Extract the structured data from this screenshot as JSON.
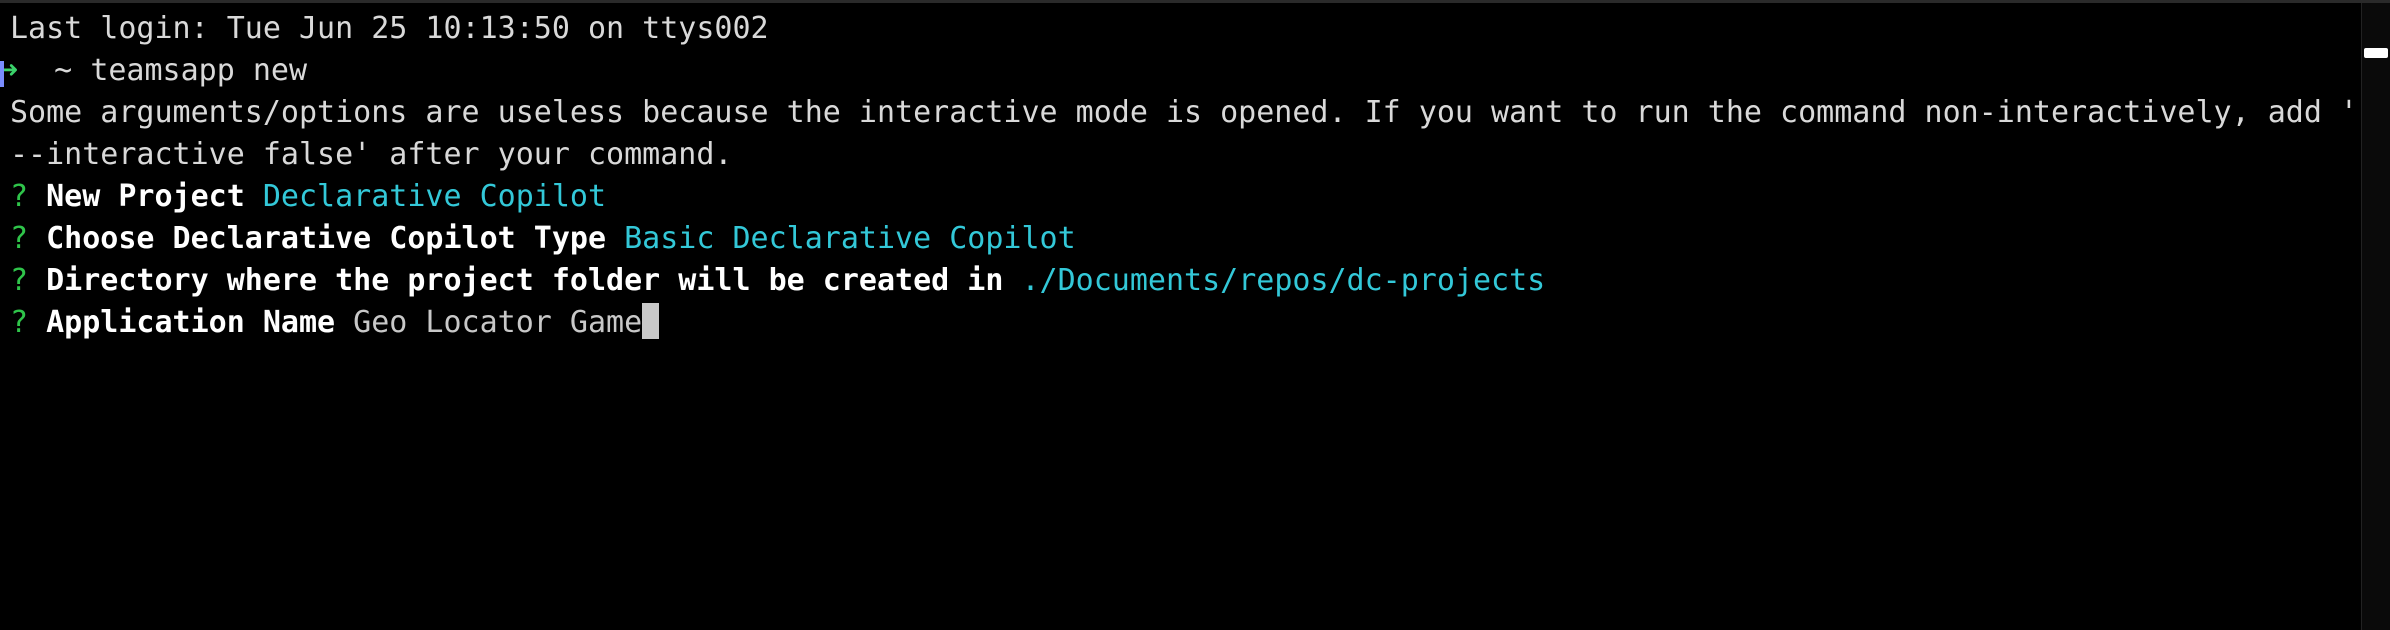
{
  "terminal": {
    "last_login": "Last login: Tue Jun 25 10:13:50 on ttys002",
    "prompt_arrow": "➜",
    "prompt_path": "  ~ ",
    "command": "teamsapp new",
    "notice_line1": "Some arguments/options are useless because the interactive mode is opened. If you want to run the command non-interactively, add '",
    "notice_line2": "--interactive false' after your command.",
    "questions": [
      {
        "mark": "?",
        "question": "New Project",
        "answer": "Declarative Copilot"
      },
      {
        "mark": "?",
        "question": "Choose Declarative Copilot Type",
        "answer": "Basic Declarative Copilot"
      },
      {
        "mark": "?",
        "question": "Directory where the project folder will be created in",
        "answer": "./Documents/repos/dc-projects"
      },
      {
        "mark": "?",
        "question": "Application Name",
        "answer": "Geo Locator Game"
      }
    ]
  },
  "colors": {
    "background": "#000000",
    "text": "#d9d9d9",
    "question_mark": "#2fc44a",
    "answer": "#33c8d8",
    "cursor": "#c9c9c9"
  }
}
